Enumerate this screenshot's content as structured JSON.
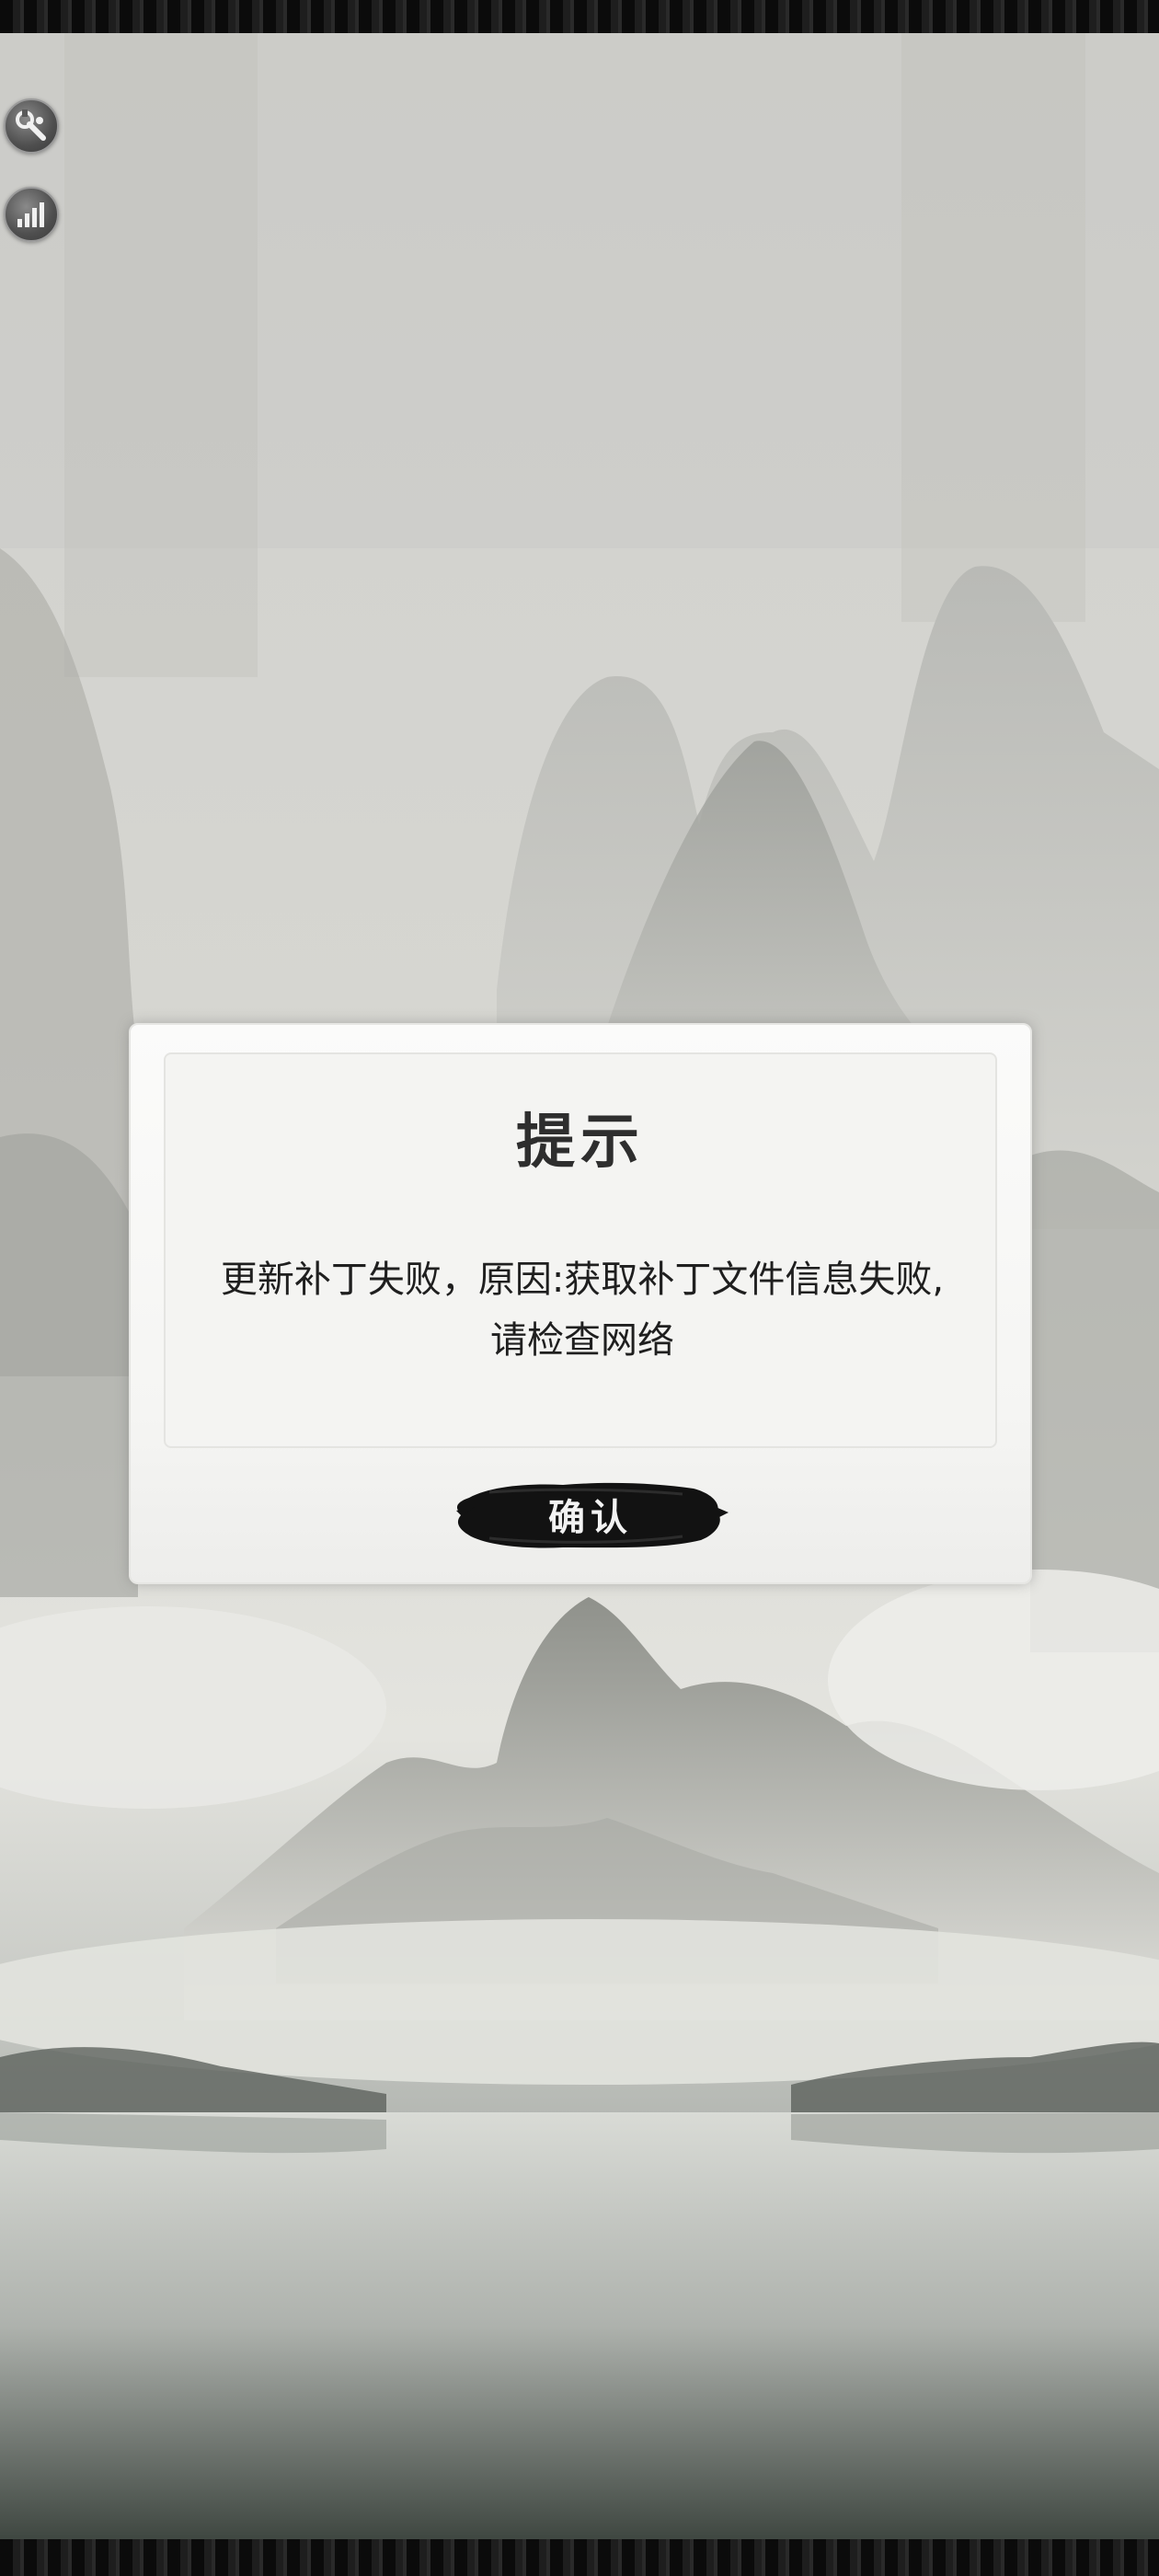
{
  "toolbar": {
    "tools_icon": "wrench-icon",
    "network_icon": "signal-bars-icon"
  },
  "dialog": {
    "title": "提示",
    "message": "更新补丁失败，原因:获取补丁文件信息失败,请检查网络",
    "confirm_label": "确认"
  },
  "colors": {
    "dialog_bg": "#f5f5f3",
    "button_ink": "#111111",
    "text": "#1f1f1f"
  }
}
